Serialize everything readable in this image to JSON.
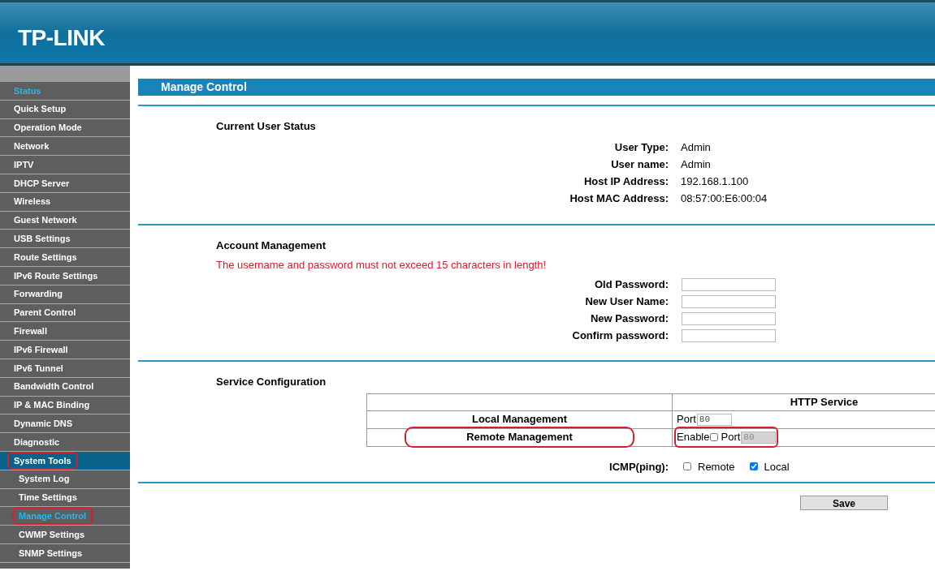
{
  "brand": "TP-LINK",
  "sidebar": {
    "items": [
      {
        "label": "Status",
        "selected": true,
        "annotated": false
      },
      {
        "label": "Quick Setup",
        "selected": false,
        "annotated": false
      },
      {
        "label": "Operation Mode",
        "selected": false,
        "annotated": false
      },
      {
        "label": "Network",
        "selected": false,
        "annotated": false
      },
      {
        "label": "IPTV",
        "selected": false,
        "annotated": false
      },
      {
        "label": "DHCP Server",
        "selected": false,
        "annotated": false
      },
      {
        "label": "Wireless",
        "selected": false,
        "annotated": false
      },
      {
        "label": "Guest Network",
        "selected": false,
        "annotated": false
      },
      {
        "label": "USB Settings",
        "selected": false,
        "annotated": false
      },
      {
        "label": "Route Settings",
        "selected": false,
        "annotated": false
      },
      {
        "label": "IPv6 Route Settings",
        "selected": false,
        "annotated": false
      },
      {
        "label": "Forwarding",
        "selected": false,
        "annotated": false
      },
      {
        "label": "Parent Control",
        "selected": false,
        "annotated": false
      },
      {
        "label": "Firewall",
        "selected": false,
        "annotated": false
      },
      {
        "label": "IPv6 Firewall",
        "selected": false,
        "annotated": false
      },
      {
        "label": "IPv6 Tunnel",
        "selected": false,
        "annotated": false
      },
      {
        "label": "Bandwidth Control",
        "selected": false,
        "annotated": false
      },
      {
        "label": "IP & MAC Binding",
        "selected": false,
        "annotated": false
      },
      {
        "label": "Dynamic DNS",
        "selected": false,
        "annotated": false
      },
      {
        "label": "Diagnostic",
        "selected": false,
        "annotated": false
      },
      {
        "label": "System Tools",
        "selected": false,
        "annotated": true,
        "expanded": true,
        "children": [
          {
            "label": "System Log",
            "selected": false,
            "annotated": false
          },
          {
            "label": "Time Settings",
            "selected": false,
            "annotated": false
          },
          {
            "label": "Manage Control",
            "selected": true,
            "annotated": true
          },
          {
            "label": "CWMP Settings",
            "selected": false,
            "annotated": false
          },
          {
            "label": "SNMP Settings",
            "selected": false,
            "annotated": false
          }
        ]
      }
    ]
  },
  "page_title": "Manage Control",
  "current_user_status": {
    "title": "Current User Status",
    "fields": [
      {
        "label": "User Type:",
        "value": "Admin"
      },
      {
        "label": "User name:",
        "value": "Admin"
      },
      {
        "label": "Host IP Address:",
        "value": "192.168.1.100"
      },
      {
        "label": "Host MAC Address:",
        "value": "08:57:00:E6:00:04"
      }
    ]
  },
  "account_management": {
    "title": "Account Management",
    "warning": "The username and password must not exceed 15 characters in length!",
    "fields": [
      {
        "label": "Old Password:"
      },
      {
        "label": "New User Name:"
      },
      {
        "label": "New Password:"
      },
      {
        "label": "Confirm password:"
      }
    ]
  },
  "service_configuration": {
    "title": "Service Configuration",
    "header": "HTTP Service",
    "rows": [
      {
        "label": "Local Management",
        "annotated": false,
        "port_label": "Port",
        "port_value": "80",
        "port_disabled": false,
        "controls_annotated": false
      },
      {
        "label": "Remote Management",
        "annotated": true,
        "enable_label": "Enable",
        "enable_checked": false,
        "port_label": "Port",
        "port_value": "80",
        "port_disabled": true,
        "controls_annotated": true
      }
    ],
    "icmp": {
      "label": "ICMP(ping):",
      "options": [
        {
          "label": "Remote",
          "checked": false
        },
        {
          "label": "Local",
          "checked": true
        }
      ]
    }
  },
  "save_button": "Save"
}
